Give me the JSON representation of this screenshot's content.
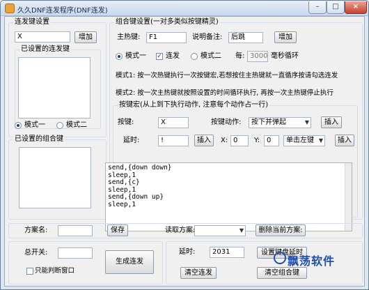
{
  "window": {
    "title": "久久DNF连发程序(DNF连发)",
    "minimize": "–",
    "maximize": "□",
    "close": "×"
  },
  "left_panel": {
    "hotkey_group_title": "连发键设置",
    "hotkey_value": "X",
    "add_button": "增加",
    "set_keys_group_title": "已设置的连发键",
    "mode1_label": "模式一",
    "mode2_label": "模式二",
    "combo_group_title": "已设置的组合键"
  },
  "combo_settings": {
    "group_title": "组合键设置(一对多类似按键精灵)",
    "main_hotkey_label": "主热键:",
    "main_hotkey_value": "F1",
    "note_label": "说明备注:",
    "note_value": "后跳",
    "add_button": "增加",
    "mode1_label": "模式一",
    "burst_label": "连发",
    "mode2_label": "模式二",
    "every_label": "每:",
    "interval_value": "3000",
    "interval_unit": "毫秒循环",
    "desc_mode1": "模式1: 按一次热键执行一次按键宏,若想按住主热键就一直循序按请勾选连发",
    "desc_mode2": "模式2: 按一次主热键就按照设置的时间循环执行, 再按一次主热键停止执行"
  },
  "macro": {
    "group_title": "按键宏(从上到下执行动作, 注意每个动作占一行)",
    "key_label": "按键:",
    "key_value": "X",
    "action_label": "按键动作:",
    "action_selected": "按下并弹起",
    "insert_button": "插入",
    "delay_label": "延时:",
    "delay_value": "!",
    "insert_button2": "插入",
    "x_label": "X:",
    "x_value": "0",
    "y_label": "Y:",
    "y_value": "0",
    "click_selected": "单击左键",
    "insert_button3": "插入",
    "lines": [
      "send,{down down}",
      "sleep,1",
      "send,{c}",
      "sleep,1",
      "send,{down up}",
      "sleep,1"
    ]
  },
  "scheme": {
    "name_label": "方案名:",
    "name_value": "",
    "save_button": "保存",
    "read_label": "读取方案:",
    "read_selected": "",
    "delete_button": "删除当前方案:"
  },
  "bottom": {
    "master_switch_label": "总开关:",
    "master_switch_value": "",
    "only_window_label": "只能判断窗口",
    "generate_button": "生成连发",
    "delay_label": "延时:",
    "delay_value": "2031",
    "set_key_delay_button": "设置键盘延时",
    "clear_burst_button": "清空连发",
    "clear_combo_button": "清空组合键"
  },
  "watermark": {
    "text": "飘荡软件"
  }
}
